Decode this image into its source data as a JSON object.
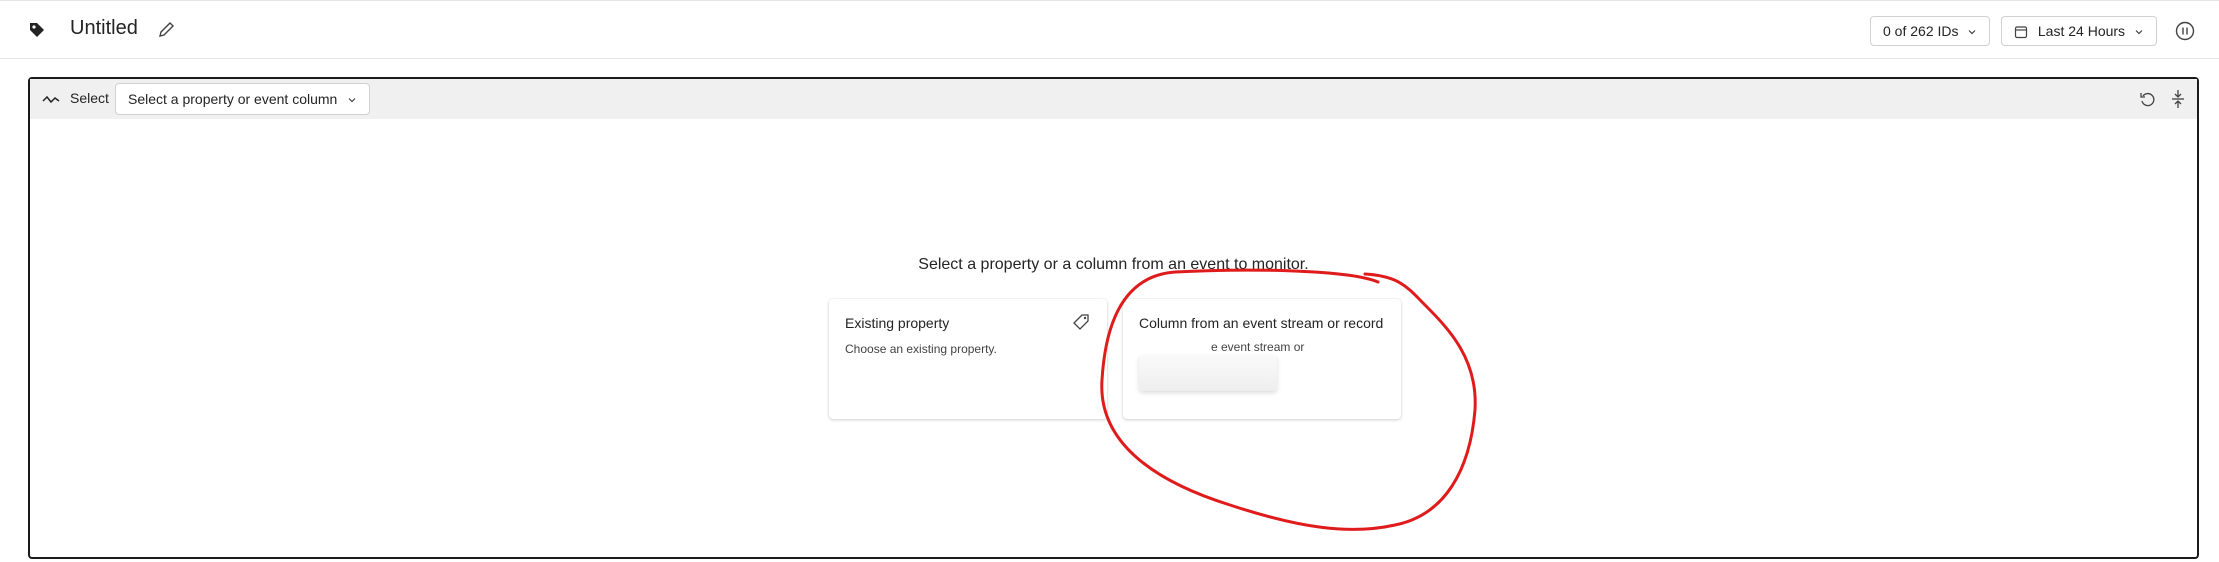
{
  "header": {
    "title": "Untitled",
    "ids_button": "0 of 262 IDs",
    "time_range_button": "Last 24 Hours"
  },
  "panel": {
    "select_label": "Select",
    "dropdown_label": "Select a property or event column",
    "prompt": "Select a property or a column from an event to monitor.",
    "cards": [
      {
        "title": "Existing property",
        "description": "Choose an existing property."
      },
      {
        "title": "Column from an event stream or record",
        "description": "e event stream or"
      }
    ]
  },
  "annotation": {
    "color": "#e01b1b",
    "shape": "hand-drawn circle around second card"
  }
}
